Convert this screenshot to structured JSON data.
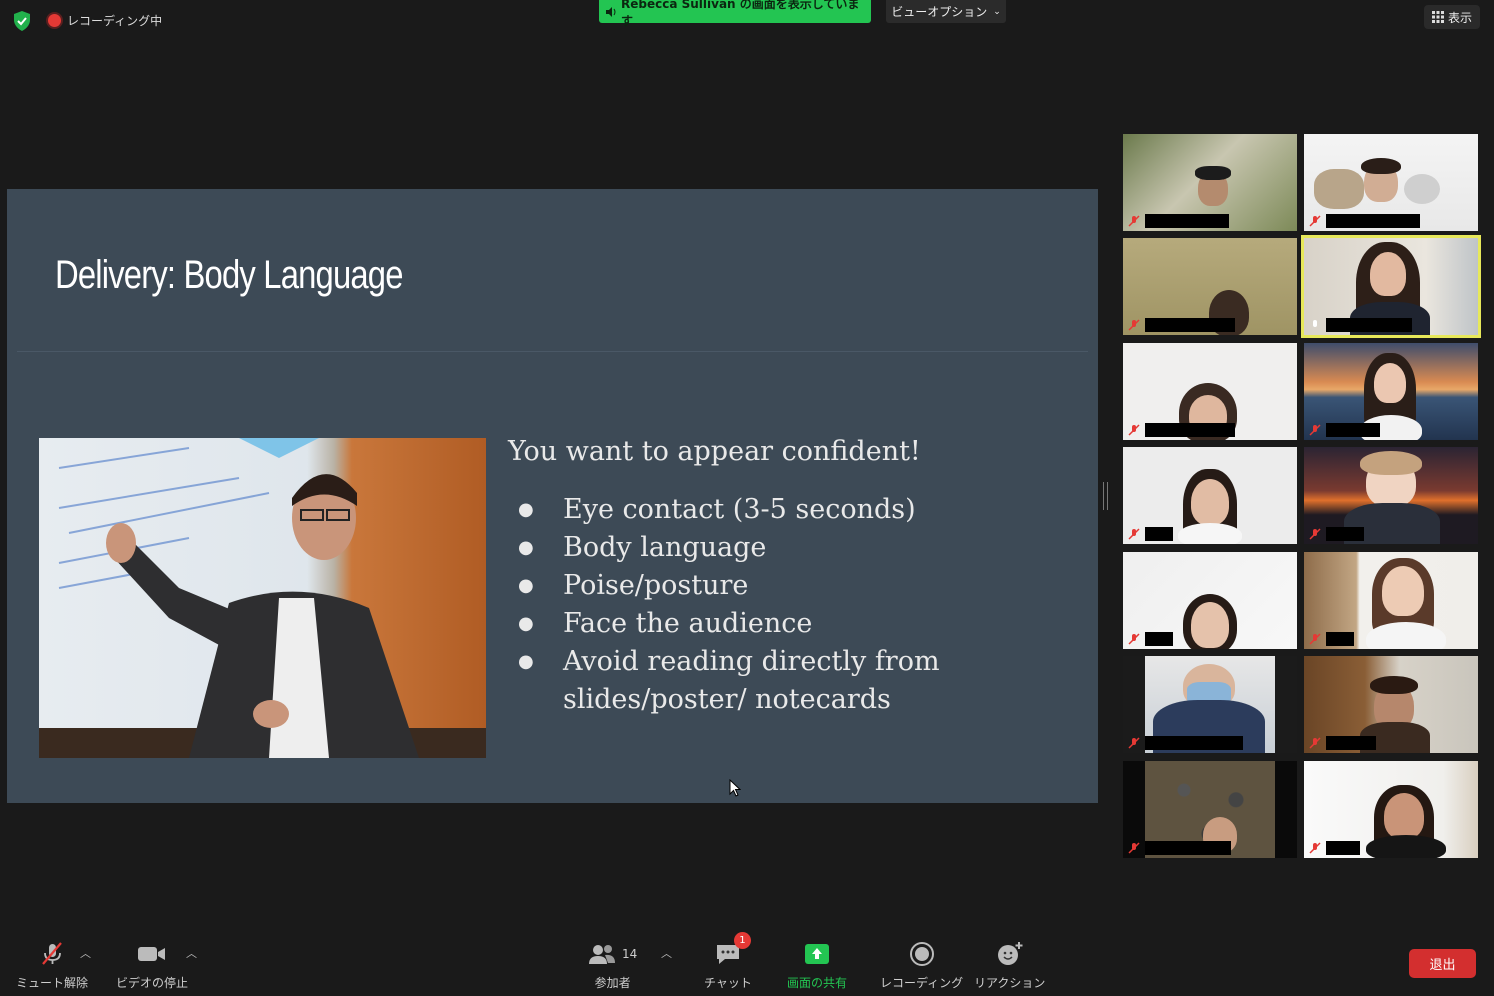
{
  "topbar": {
    "recording_label": "レコーディング中",
    "share_banner": "Rebecca Sullivan の画面を表示しています",
    "view_options": "ビューオプション",
    "display_label": "表示"
  },
  "slide": {
    "title": "Delivery: Body Language",
    "heading": "You want to appear confident!",
    "bullets": [
      "Eye contact (3-5 seconds)",
      "Body language",
      "Poise/posture",
      "Face the audience",
      "Avoid reading directly from slides/poster/ notecards"
    ]
  },
  "toolbar": {
    "unmute": "ミュート解除",
    "stop_video": "ビデオの停止",
    "participants": "参加者",
    "participants_count": "14",
    "chat": "チャット",
    "chat_badge": "1",
    "share_screen": "画面の共有",
    "recording": "レコーディング",
    "reactions": "リアクション",
    "leave": "退出"
  },
  "colors": {
    "share_green": "#23c552",
    "leave_red": "#d32f2f",
    "active_speaker": "#e7e85a",
    "slide_bg": "#3d4a56"
  }
}
